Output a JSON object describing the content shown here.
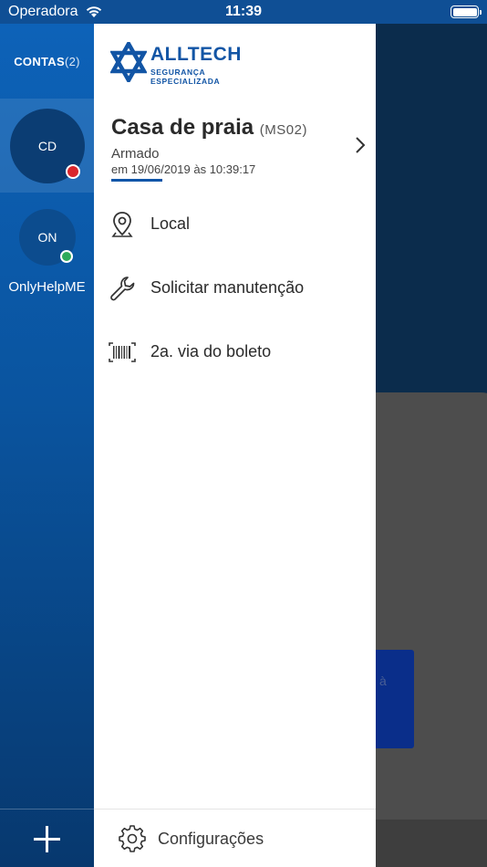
{
  "status_bar": {
    "carrier": "Operadora",
    "time": "11:39"
  },
  "accounts": {
    "title": "CONTAS",
    "count": "(2)",
    "items": [
      {
        "initials": "CD",
        "status": "red",
        "selected": true
      },
      {
        "initials": "ON",
        "name": "OnlyHelpME",
        "status": "green",
        "selected": false
      }
    ]
  },
  "drawer": {
    "logo": {
      "brand": "ALLTECH",
      "tagline": "SEGURANÇA ESPECIALIZADA"
    },
    "site": {
      "name": "Casa de praia",
      "code": "(MS02)",
      "state": "Armado",
      "date": "em 19/06/2019 às 10:39:17"
    },
    "menu": [
      {
        "label": "Local",
        "icon": "map-pin-icon"
      },
      {
        "label": "Solicitar manutenção",
        "icon": "wrench-icon"
      },
      {
        "label": "2a. via do boleto",
        "icon": "barcode-icon"
      }
    ],
    "settings_label": "Configurações"
  },
  "background_app": {
    "faint_text": "à"
  },
  "colors": {
    "primary": "#0f55a8",
    "sidebar": "#0a549f",
    "alarm_red": "#d9262c",
    "online_green": "#2eaa5a"
  }
}
